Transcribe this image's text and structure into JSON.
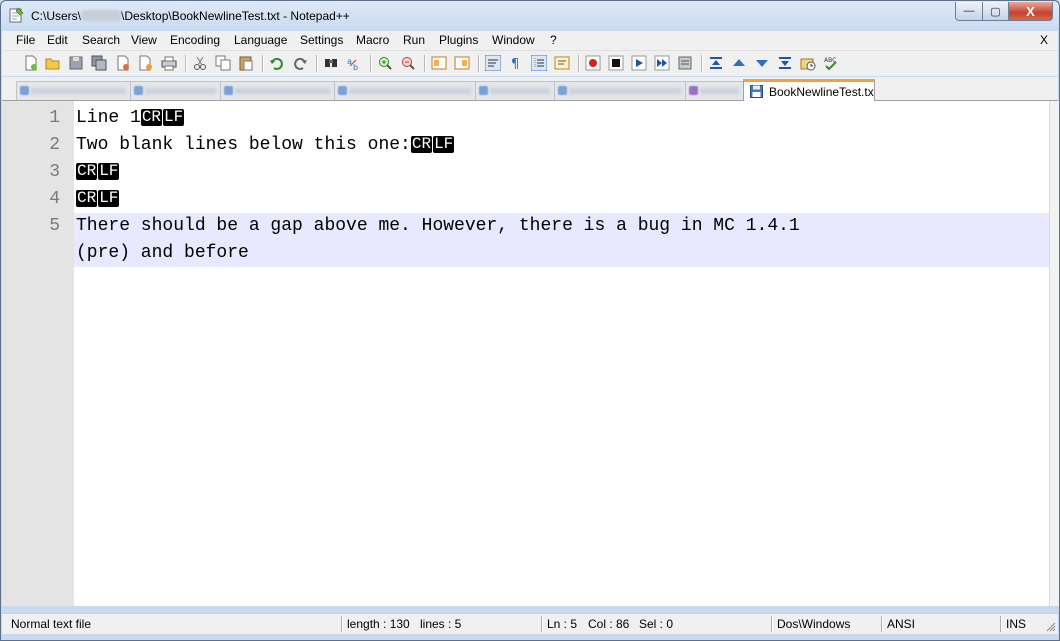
{
  "window": {
    "title_prefix": "C:\\Users\\",
    "title_suffix": "\\Desktop\\BookNewlineTest.txt - Notepad++",
    "min_label": "—",
    "max_label": "▢",
    "close_label": "X"
  },
  "menu": {
    "items": [
      "File",
      "Edit",
      "Search",
      "View",
      "Encoding",
      "Language",
      "Settings",
      "Macro",
      "Run",
      "Plugins",
      "Window",
      "?"
    ],
    "close_doc": "X"
  },
  "tabs": {
    "active_label": "BookNewlineTest.txt"
  },
  "editor": {
    "line_numbers": [
      "1",
      "2",
      "3",
      "4",
      "5"
    ],
    "eol_markers": [
      "CR",
      "LF"
    ],
    "lines": {
      "l1": "Line 1",
      "l2": "Two blank lines below this one:",
      "l5a": "There should be a gap above me. However, there is a bug in MC 1.4.1",
      "l5b": "(pre) and before"
    }
  },
  "status": {
    "file_type": "Normal text file",
    "length": "length : 130",
    "lines": "lines : 5",
    "ln": "Ln : 5",
    "col": "Col : 86",
    "sel": "Sel : 0",
    "eol_format": "Dos\\Windows",
    "encoding": "ANSI",
    "mode": "INS"
  },
  "colors": {
    "caret_line": "#e8e8ff",
    "gutter": "#e4e4e4",
    "active_tab_accent": "#f4a13a"
  }
}
